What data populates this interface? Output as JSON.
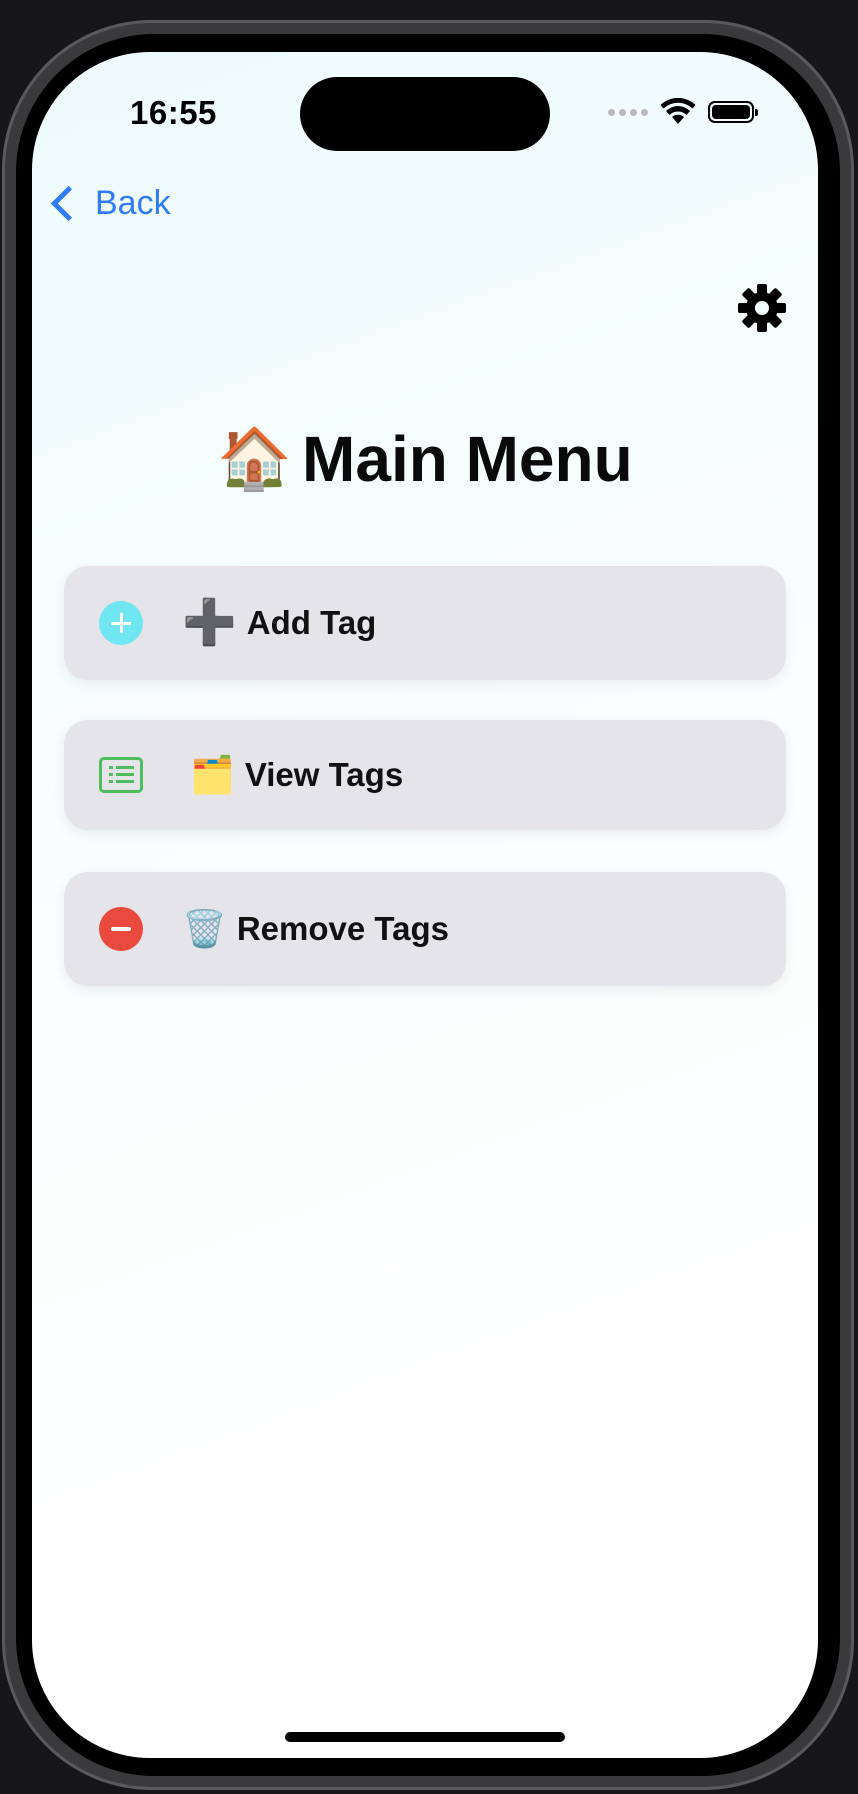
{
  "status_bar": {
    "time": "16:55",
    "icons": [
      "signal-icon",
      "wifi-icon",
      "battery-icon"
    ]
  },
  "nav": {
    "back_label": "Back",
    "settings_icon": "gear-icon"
  },
  "title": {
    "emoji": "🏠",
    "text": "Main Menu"
  },
  "menu": {
    "items": [
      {
        "label": "Add Tag",
        "prefix": "➕",
        "icon": "plus-circle-icon",
        "icon_color": "#6fe6f2"
      },
      {
        "label": "View Tags",
        "prefix": "🗂️",
        "icon": "list-icon",
        "icon_color": "#4cbe5d"
      },
      {
        "label": "Remove Tags",
        "prefix": "🗑️",
        "icon": "minus-circle-icon",
        "icon_color": "#ea4a3d"
      }
    ]
  },
  "colors": {
    "accent": "#2f7cf6",
    "button_bg": "#e5e4e9"
  }
}
